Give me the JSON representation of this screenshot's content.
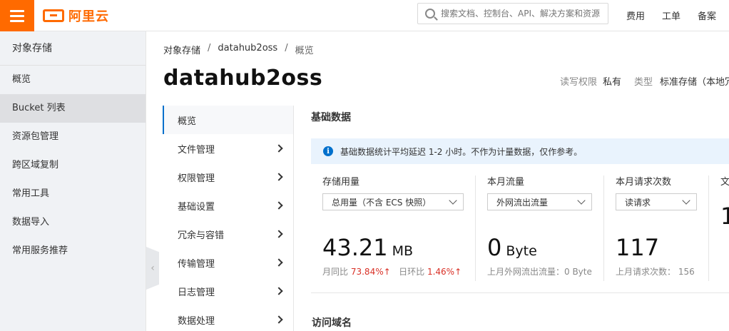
{
  "topbar": {
    "brand": "阿里云",
    "search_placeholder": "搜索文档、控制台、API、解决方案和资源",
    "links": [
      "费用",
      "工单",
      "备案"
    ],
    "accent_color": "#ff6a00"
  },
  "sidebar": {
    "title": "对象存储",
    "items": [
      {
        "label": "概览"
      },
      {
        "label": "Bucket 列表"
      },
      {
        "label": "资源包管理"
      },
      {
        "label": "跨区域复制"
      },
      {
        "label": "常用工具"
      },
      {
        "label": "数据导入"
      },
      {
        "label": "常用服务推荐"
      }
    ],
    "active_index": 1,
    "collapse_icon": "chevron-left-icon"
  },
  "breadcrumb": [
    "对象存储",
    "datahub2oss",
    "概览"
  ],
  "page": {
    "title": "datahub2oss",
    "meta": [
      {
        "label": "读写权限",
        "value": "私有"
      },
      {
        "label": "类型",
        "value": "标准存储（本地冗"
      }
    ]
  },
  "bucket_nav": {
    "items": [
      {
        "label": "概览",
        "has_children": false
      },
      {
        "label": "文件管理",
        "has_children": true
      },
      {
        "label": "权限管理",
        "has_children": true
      },
      {
        "label": "基础设置",
        "has_children": true
      },
      {
        "label": "冗余与容错",
        "has_children": true
      },
      {
        "label": "传输管理",
        "has_children": true
      },
      {
        "label": "日志管理",
        "has_children": true
      },
      {
        "label": "数据处理",
        "has_children": true
      }
    ],
    "active_index": 0
  },
  "basic_data": {
    "section_title": "基础数据",
    "notice": "基础数据统计平均延迟 1-2 小时。不作为计量数据，仅作参考。",
    "stats": [
      {
        "label": "存储用量",
        "select": "总用量（不含 ECS 快照）",
        "value": "43.21",
        "unit": "MB",
        "sub": [
          {
            "label": "月同比",
            "value": "73.84%↑"
          },
          {
            "label": "日环比",
            "value": "1.46%↑"
          }
        ]
      },
      {
        "label": "本月流量",
        "select": "外网流出流量",
        "value": "0",
        "unit": "Byte",
        "sub_text": "上月外网流出流量：0 Byte"
      },
      {
        "label": "本月请求次数",
        "select": "读请求",
        "value": "117",
        "unit": "",
        "sub_text": "上月请求次数：  156"
      },
      {
        "label": "文",
        "value": "1"
      }
    ]
  },
  "access_domain": {
    "section_title": "访问域名"
  }
}
